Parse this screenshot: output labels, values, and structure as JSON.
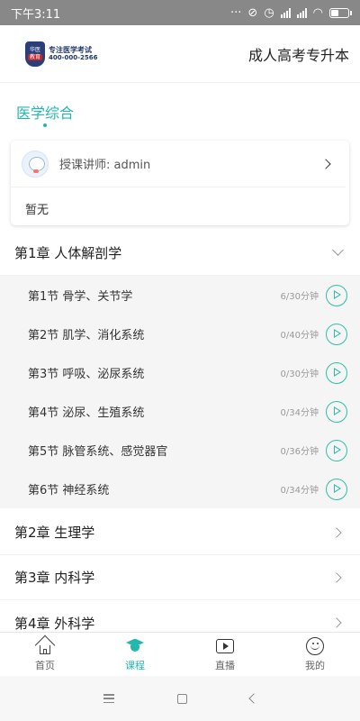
{
  "status_bar": {
    "time": "下午3:11",
    "icons": [
      "more-dots-icon",
      "mute-icon",
      "alarm-icon",
      "signal-hd-icon",
      "signal-icon",
      "wifi-icon",
      "battery-icon"
    ]
  },
  "header": {
    "logo": {
      "badge_line1": "华医",
      "badge_line2": "教育",
      "line1": "专注医学考试",
      "line2": "400-000-2566"
    },
    "title": "成人高考专升本"
  },
  "subject_tab": {
    "label": "医学综合",
    "accent": "#22b8b0"
  },
  "teacher_card": {
    "teacher_label": "授课讲师: admin",
    "description": "暂无"
  },
  "chapters": [
    {
      "title": "第1章 人体解剖学",
      "expanded": true,
      "sections": [
        {
          "title": "第1节 骨学、关节学",
          "duration": "6/30分钟"
        },
        {
          "title": "第2节 肌学、消化系统",
          "duration": "0/40分钟"
        },
        {
          "title": "第3节 呼吸、泌尿系统",
          "duration": "0/30分钟"
        },
        {
          "title": "第4节 泌尿、生殖系统",
          "duration": "0/34分钟"
        },
        {
          "title": "第5节 脉管系统、感觉器官",
          "duration": "0/36分钟"
        },
        {
          "title": "第6节 神经系统",
          "duration": "0/34分钟"
        }
      ]
    },
    {
      "title": "第2章 生理学",
      "expanded": false
    },
    {
      "title": "第3章 内科学",
      "expanded": false
    },
    {
      "title": "第4章 外科学",
      "expanded": false
    }
  ],
  "bottom_nav": [
    {
      "label": "首页",
      "icon": "home-icon",
      "active": false
    },
    {
      "label": "课程",
      "icon": "graduation-cap-icon",
      "active": true
    },
    {
      "label": "直播",
      "icon": "live-play-icon",
      "active": false
    },
    {
      "label": "我的",
      "icon": "smiley-icon",
      "active": false
    }
  ],
  "colors": {
    "accent": "#22b8b0",
    "play_icon": "#2fbfa8",
    "status_bar": "#888888"
  }
}
